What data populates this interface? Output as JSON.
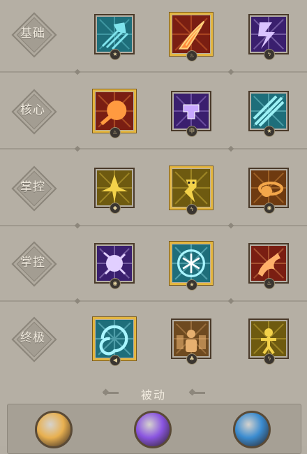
{
  "rows": [
    {
      "label": "基础",
      "skills": [
        {
          "name": "frost-arrows-icon",
          "colors": [
            "#1e6e7a",
            "#7fe3ec"
          ],
          "badge": "★",
          "selected": false
        },
        {
          "name": "fire-slash-icon",
          "colors": [
            "#7a1e12",
            "#ff8a3a"
          ],
          "badge": "♨",
          "selected": true
        },
        {
          "name": "lightning-icon",
          "colors": [
            "#3a1f6e",
            "#d9c3ff"
          ],
          "badge": "ϟ",
          "selected": false
        }
      ]
    },
    {
      "label": "核心",
      "skills": [
        {
          "name": "fireball-icon",
          "colors": [
            "#7a1e12",
            "#ff9a40"
          ],
          "badge": "♨",
          "selected": true
        },
        {
          "name": "shock-fist-icon",
          "colors": [
            "#3a1f6e",
            "#c8a8ff"
          ],
          "badge": "中",
          "selected": false
        },
        {
          "name": "ice-shards-icon",
          "colors": [
            "#1e6e7a",
            "#9cf1f5"
          ],
          "badge": "★",
          "selected": false
        }
      ]
    },
    {
      "label": "掌控",
      "skills": [
        {
          "name": "spike-burst-icon",
          "colors": [
            "#6e5a10",
            "#f3d24a"
          ],
          "badge": "◆",
          "selected": false
        },
        {
          "name": "chain-lightning-icon",
          "colors": [
            "#6e5a10",
            "#f3d24a"
          ],
          "badge": "ϟ",
          "selected": true
        },
        {
          "name": "meteor-icon",
          "colors": [
            "#6e3a10",
            "#f2a64a"
          ],
          "badge": "◉",
          "selected": false
        }
      ]
    },
    {
      "label": "掌控",
      "skills": [
        {
          "name": "storm-orb-icon",
          "colors": [
            "#3a1f6e",
            "#e1cfff"
          ],
          "badge": "◉",
          "selected": false
        },
        {
          "name": "snowflake-icon",
          "colors": [
            "#1e6e7a",
            "#a9f5ff"
          ],
          "badge": "★",
          "selected": true
        },
        {
          "name": "fire-dragon-icon",
          "colors": [
            "#7a1e12",
            "#ffb06a"
          ],
          "badge": "♨",
          "selected": false
        }
      ]
    },
    {
      "label": "终极",
      "skills": [
        {
          "name": "blizzard-icon",
          "colors": [
            "#1e6e7a",
            "#a9f5ff"
          ],
          "badge": "◀",
          "selected": true
        },
        {
          "name": "summon-icon",
          "colors": [
            "#6e4a20",
            "#e6b070"
          ],
          "badge": "♣",
          "selected": false
        },
        {
          "name": "avatar-icon",
          "colors": [
            "#6e5a10",
            "#f3d24a"
          ],
          "badge": "ϟ",
          "selected": false
        }
      ]
    }
  ],
  "passive": {
    "title": "被动",
    "orbs": [
      {
        "name": "fire-orb-icon",
        "color": "#e8b050"
      },
      {
        "name": "lightning-orb-icon",
        "color": "#8a55e0"
      },
      {
        "name": "frost-orb-icon",
        "color": "#3b8cd0"
      }
    ]
  }
}
